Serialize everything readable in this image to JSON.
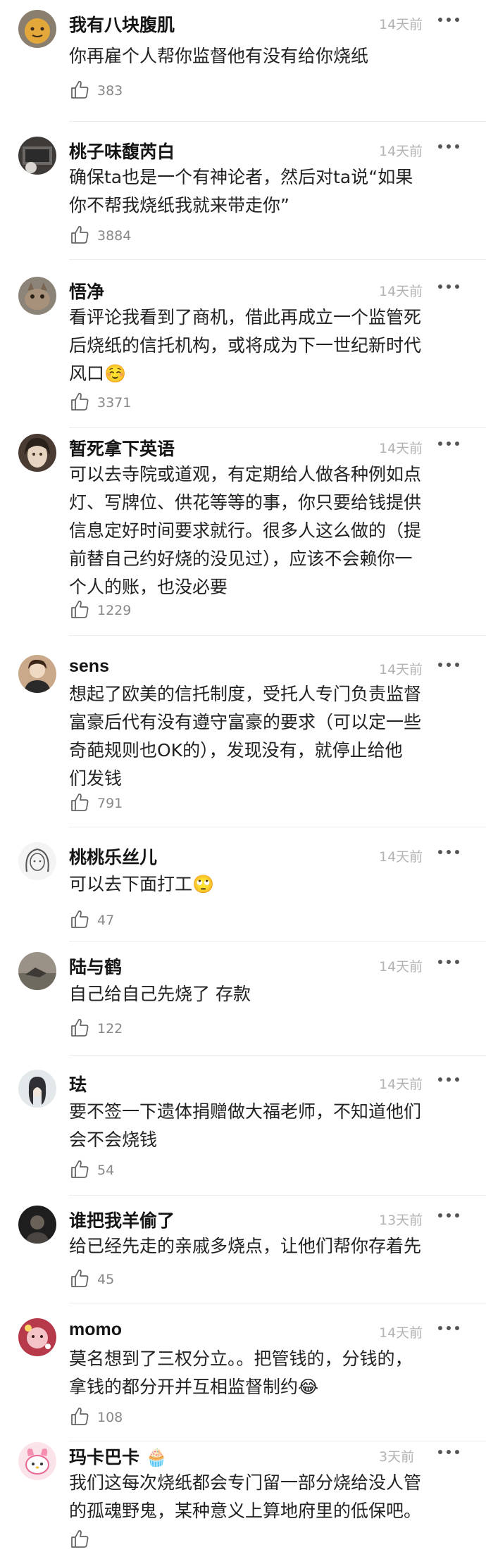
{
  "comments": [
    {
      "username": "我有八块腹肌",
      "time": "14天前",
      "content": "你再雇个人帮你监督他有没有给你烧纸",
      "likes": "383"
    },
    {
      "username": "桃子味馥芮白",
      "time": "14天前",
      "content": "确保ta也是一个有神论者，然后对ta说“如果\n你不帮我烧纸我就来带走你”",
      "likes": "3884"
    },
    {
      "username": "悟净",
      "time": "14天前",
      "content": "看评论我看到了商机，借此再成立一个监管死\n后烧纸的信托机构，或将成为下一世纪新时代\n风口☺️",
      "likes": "3371"
    },
    {
      "username": "暂死拿下英语",
      "time": "14天前",
      "content": "可以去寺院或道观，有定期给人做各种例如点\n灯、写牌位、供花等等的事，你只要给钱提供\n信息定好时间要求就行。很多人这么做的（提\n前替自己约好烧的没见过），应该不会赖你一\n个人的账，也没必要",
      "likes": "1229"
    },
    {
      "username": "sens",
      "time": "14天前",
      "content": "想起了欧美的信托制度，受托人专门负责监督\n富豪后代有没有遵守富豪的要求（可以定一些\n奇葩规则也OK的），发现没有，就停止给他\n们发钱",
      "likes": "791"
    },
    {
      "username": "桃桃乐丝儿",
      "time": "14天前",
      "content": "可以去下面打工🙄",
      "likes": "47"
    },
    {
      "username": "陆与鹤",
      "time": "14天前",
      "content": "自己给自己先烧了 存款",
      "likes": "122"
    },
    {
      "username": "珐",
      "time": "14天前",
      "content": "要不签一下遗体捐赠做大福老师，不知道他们\n会不会烧钱",
      "likes": "54"
    },
    {
      "username": "谁把我羊偷了",
      "time": "13天前",
      "content": "给已经先走的亲戚多烧点，让他们帮你存着先",
      "likes": "45"
    },
    {
      "username": "momo",
      "time": "14天前",
      "content": "莫名想到了三权分立。。把管钱的，分钱的，\n拿钱的都分开并互相监督制约😂",
      "likes": "108"
    },
    {
      "username": "玛卡巴卡 🧁",
      "time": "3天前",
      "content": "我们这每次烧纸都会专门留一部分烧给没人管\n的孤魂野鬼，某种意义上算地府里的低保吧。",
      "likes": ""
    }
  ],
  "icons": {
    "more": "more-dots-icon",
    "like": "thumbs-up-icon"
  },
  "colors": {
    "username": "#151515",
    "time": "#b3b3b3",
    "content": "#222222",
    "like": "#888888"
  }
}
